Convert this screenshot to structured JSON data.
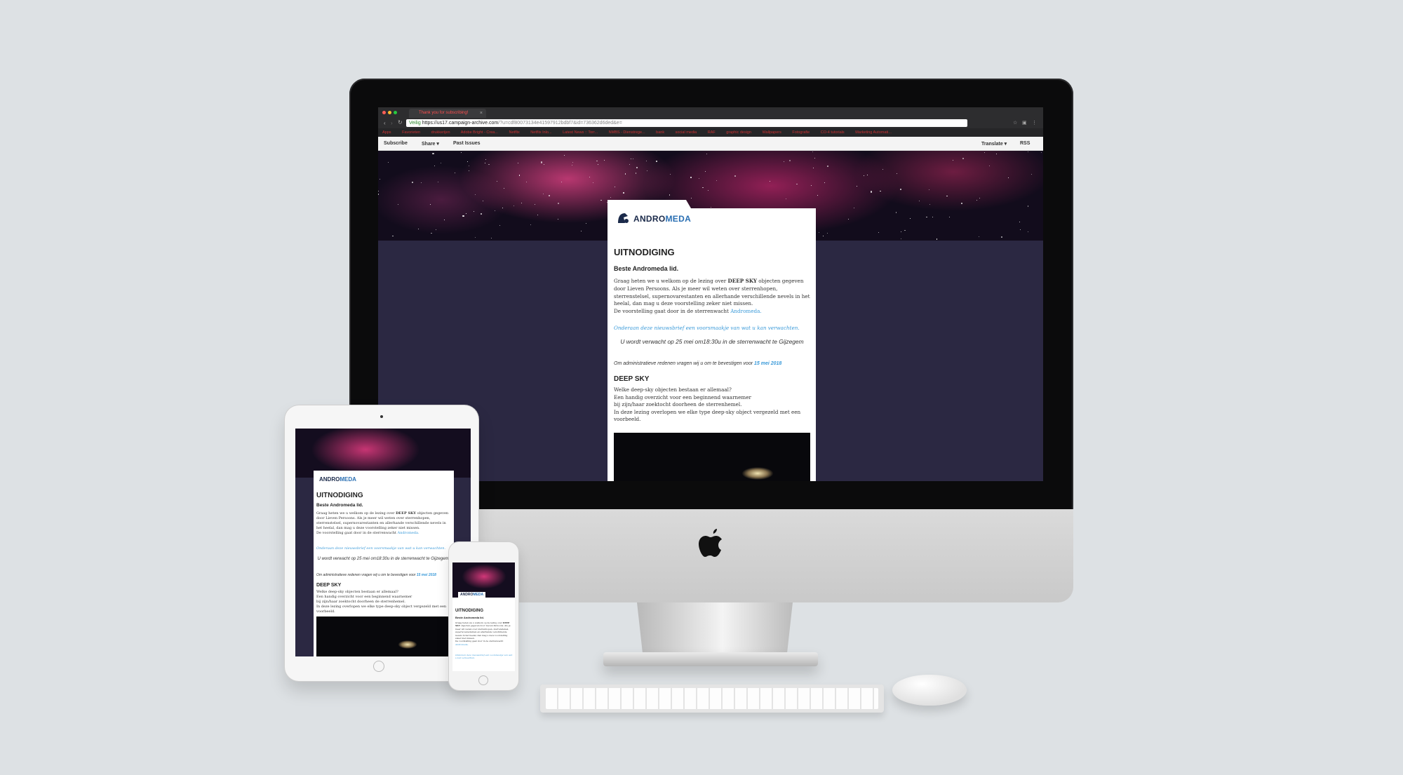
{
  "browser": {
    "tab_title": "Thank you for subscribing!",
    "tab_close": "×",
    "url_secure": "Veilig",
    "url_host": "https://us17.campaign-archive.com",
    "url_rest": "/?u=cdf80073134e41597912bdbf7&id=736362d6ded&e=",
    "bookmarks": [
      "Apps",
      "Favorieten",
      "drukkerijen",
      "Adobe Bright - Crea...",
      "Netflix",
      "Netflix Inlo...",
      "Latest News :: Torr...",
      "NMBS - Dienstrege...",
      "bank",
      "social media",
      "RAF",
      "graphic design",
      "Wallpapers",
      "Fotografie",
      "CO-4 tutorials",
      "Marketing Automati..."
    ]
  },
  "mailchimp_nav": {
    "subscribe": "Subscribe",
    "share": "Share ▾",
    "past_issues": "Past Issues",
    "translate": "Translate ▾",
    "rss": "RSS"
  },
  "newsletter": {
    "logo_prefix": "ANDRO",
    "logo_suffix": "MEDA",
    "title": "UITNODIGING",
    "greeting": "Beste Andromeda lid.",
    "intro_before": "Graag heten we u welkom op de lezing over ",
    "intro_bold": "DEEP SKY",
    "intro_after": " objecten gegeven door Lieven Persoons. Als je meer wil weten over sterrenhopen, sterrenstelsel, supernovarestanten en allerhande verschillende nevels in het heelal, dan mag u deze voorstelling zeker niet missen.",
    "intro_line2": "De voorstelling gaat door in de sterrenwacht ",
    "intro_link": "Andromeda.",
    "teaser": "Onderaan deze nieuwsbrief een voorsmaakje van wat u kan verwachten.",
    "expect": "U wordt verwacht op 25 mei om18:30u in de sterrenwacht te Gijzegem",
    "admin_before": "Om administratieve redenen vragen wij u om te bevestigen voor ",
    "admin_date": "15 mei 2018",
    "section_title": "DEEP SKY",
    "section_lines": [
      "Welke deep-sky objecten bestaan er allemaal?",
      "Een handig overzicht voor een beginnend waarnemer",
      "bij zijn/haar zoektocht doorheen de sterrenhemel.",
      "In deze lezing overlopen we elke type deep-sky object vergezeld met een voorbeeld."
    ]
  },
  "colors": {
    "link": "#3a9ad9",
    "page_bg": "#2b2842",
    "backdrop": "#dde1e4"
  }
}
